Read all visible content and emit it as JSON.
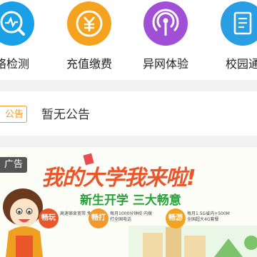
{
  "services": [
    {
      "label": "络检测",
      "icon": "network-check-icon",
      "color": "#1aa0e6"
    },
    {
      "label": "充值缴费",
      "icon": "yuan-recharge-icon",
      "color": "#f5a31f"
    },
    {
      "label": "异网体验",
      "icon": "signal-tower-icon",
      "color": "#a24fd8"
    },
    {
      "label": "校园通",
      "icon": "document-icon",
      "color": "#2a9ee3"
    }
  ],
  "notice": {
    "tag": "公告",
    "text": "暂无公告",
    "accent": "#f29a2e"
  },
  "banner": {
    "ad_tag": "广告",
    "title": "我的大学我来啦!",
    "subtitle": "新生开学 三大畅意",
    "offers": [
      {
        "badge": "畅玩",
        "desc": "高速宿舍宽带 免费送",
        "color": "#e8562a"
      },
      {
        "badge": "畅打",
        "desc": "每月1000分钟校 内拨打全国电话",
        "color": "#f29a2e"
      },
      {
        "badge": "畅游",
        "desc": "每月1.5G省内+500M 全国超大4G套餐",
        "color": "#f2a31f"
      }
    ]
  }
}
